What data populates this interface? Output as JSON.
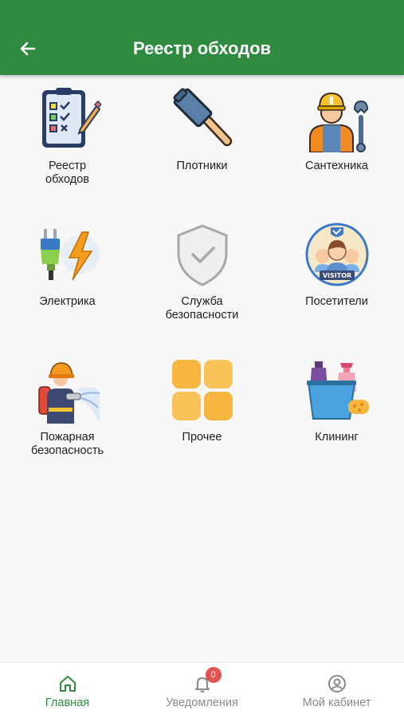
{
  "app_bar": {
    "title": "Реестр обходов",
    "back_icon": "arrow-left-icon",
    "color": "#2e8b3f"
  },
  "tiles": [
    {
      "label": "Реестр\nобходов",
      "icon": "checklist-clipboard-icon"
    },
    {
      "label": "Плотники",
      "icon": "hammer-icon"
    },
    {
      "label": "Сантехника",
      "icon": "plumber-wrench-icon"
    },
    {
      "label": "Электрика",
      "icon": "plug-lightning-icon"
    },
    {
      "label": "Служба\nбезопасности",
      "icon": "shield-check-icon"
    },
    {
      "label": "Посетители",
      "icon": "visitor-group-icon"
    },
    {
      "label": "Пожарная\nбезопасность",
      "icon": "firefighter-hose-icon"
    },
    {
      "label": "Прочее",
      "icon": "four-squares-icon"
    },
    {
      "label": "Клининг",
      "icon": "cleaning-bucket-icon"
    }
  ],
  "bottom_nav": {
    "items": [
      {
        "label": "Главная",
        "icon": "home-icon",
        "active": true
      },
      {
        "label": "Уведомления",
        "icon": "bell-icon",
        "badge": "0"
      },
      {
        "label": "Мой кабинет",
        "icon": "user-circle-icon"
      }
    ],
    "active_color": "#2e8b3f",
    "inactive_color": "#8a8a8a",
    "badge_color": "#e25555"
  }
}
